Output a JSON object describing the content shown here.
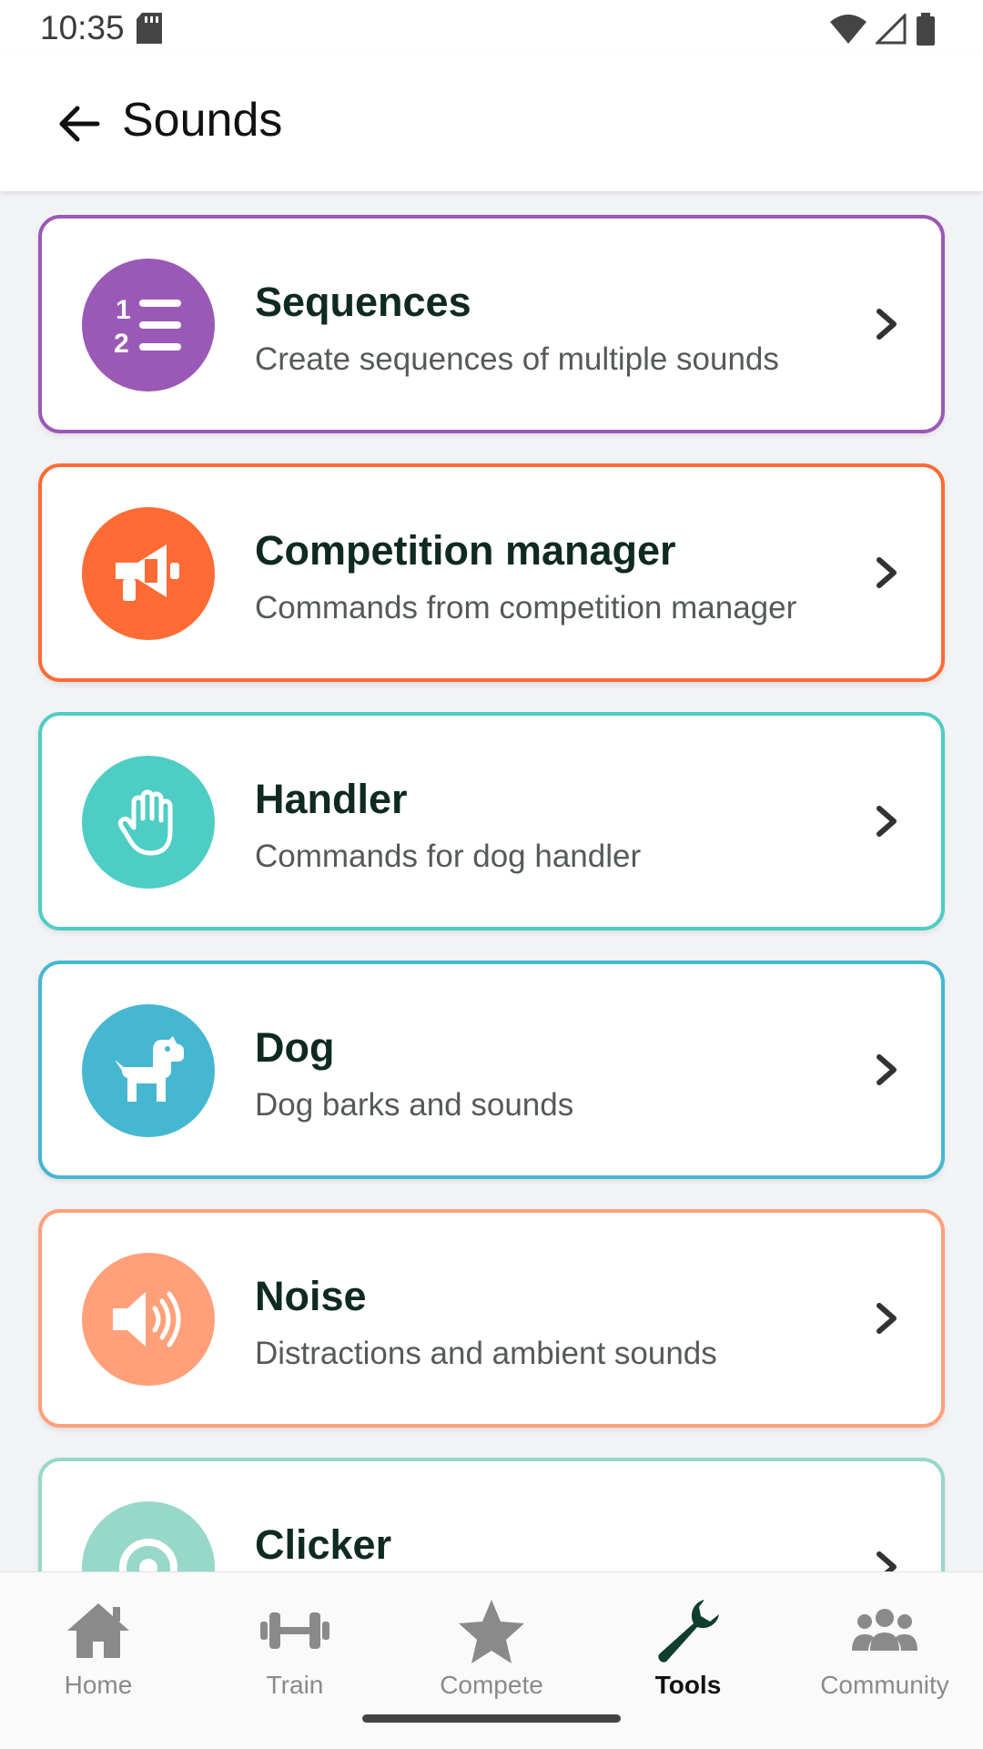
{
  "status_bar": {
    "time": "10:35"
  },
  "header": {
    "title": "Sounds"
  },
  "colors": {
    "sequences": "#9b59b6",
    "competition": "#ff6b35",
    "handler": "#4ecdc4",
    "dog": "#45b7d1",
    "noise": "#ffa07a",
    "clicker": "#98d8c8",
    "accent_dark": "#0f3d2e"
  },
  "categories": [
    {
      "title": "Sequences",
      "description": "Create sequences of multiple sounds",
      "icon": "numbered-list-icon"
    },
    {
      "title": "Competition manager",
      "description": "Commands from competition manager",
      "icon": "megaphone-icon"
    },
    {
      "title": "Handler",
      "description": "Commands for dog handler",
      "icon": "hand-icon"
    },
    {
      "title": "Dog",
      "description": "Dog barks and sounds",
      "icon": "dog-icon"
    },
    {
      "title": "Noise",
      "description": "Distractions and ambient sounds",
      "icon": "speaker-icon"
    },
    {
      "title": "Clicker",
      "description": "",
      "icon": "clicker-icon"
    }
  ],
  "nav": [
    {
      "label": "Home",
      "icon": "home-icon"
    },
    {
      "label": "Train",
      "icon": "dumbbell-icon"
    },
    {
      "label": "Compete",
      "icon": "star-icon"
    },
    {
      "label": "Tools",
      "icon": "wrench-icon",
      "active": true
    },
    {
      "label": "Community",
      "icon": "users-icon"
    }
  ]
}
